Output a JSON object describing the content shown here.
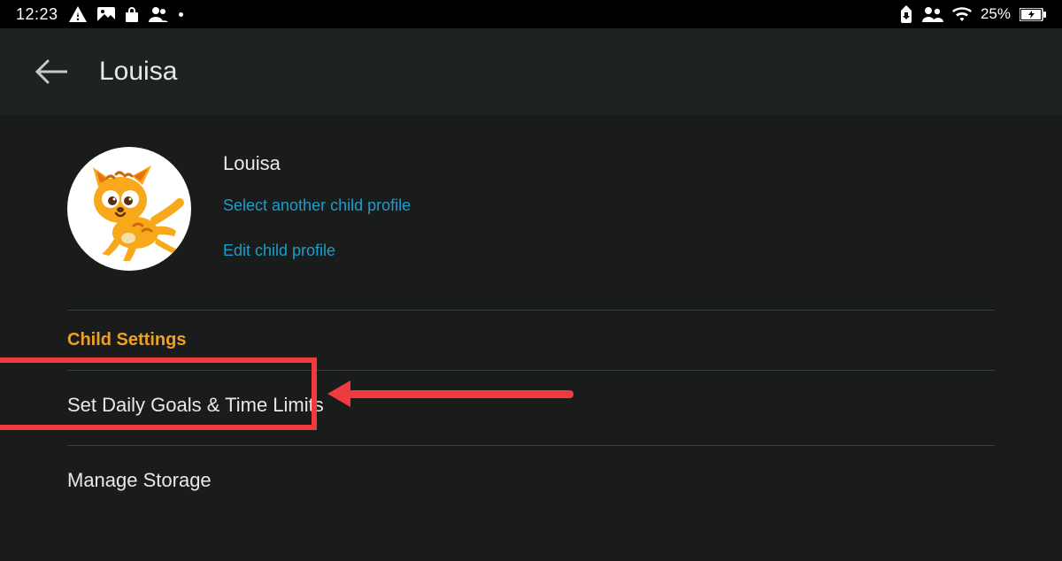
{
  "status": {
    "time": "12:23",
    "battery_pct": "25%"
  },
  "header": {
    "title": "Louisa"
  },
  "profile": {
    "name": "Louisa",
    "link_select": "Select another child profile",
    "link_edit": "Edit child profile"
  },
  "section": {
    "label": "Child Settings"
  },
  "items": {
    "goals": "Set Daily Goals & Time Limits",
    "storage": "Manage Storage"
  }
}
